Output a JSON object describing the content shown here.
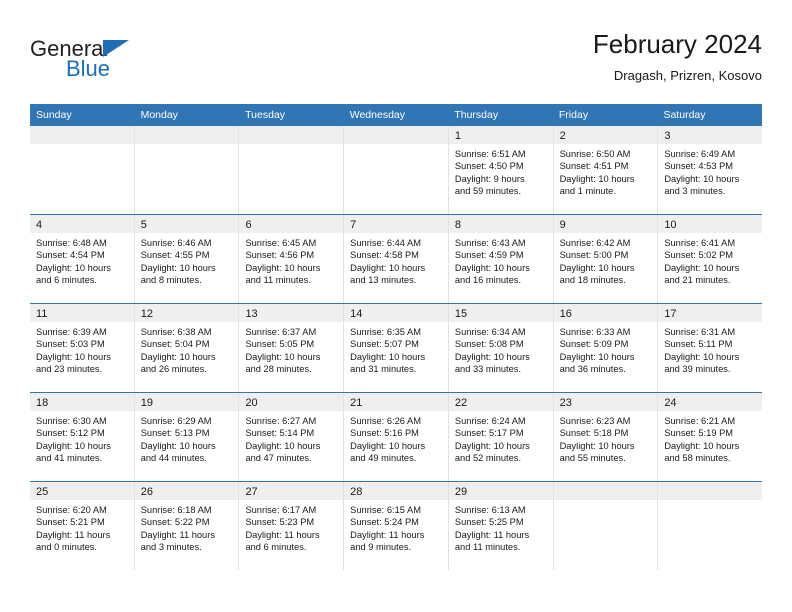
{
  "brand": {
    "name_top": "General",
    "name_bottom": "Blue",
    "triangle_icon": "triangle-icon",
    "accent_color": "#1f6eb5"
  },
  "header": {
    "title": "February 2024",
    "subtitle": "Dragash, Prizren, Kosovo"
  },
  "theme": {
    "header_blue": "#3275b5",
    "day_band_gray": "#efefef",
    "cell_border": "#e2e2e2",
    "text": "#1a1a1a"
  },
  "weekdays": [
    "Sunday",
    "Monday",
    "Tuesday",
    "Wednesday",
    "Thursday",
    "Friday",
    "Saturday"
  ],
  "weeks": [
    [
      {
        "day": "",
        "lines": []
      },
      {
        "day": "",
        "lines": []
      },
      {
        "day": "",
        "lines": []
      },
      {
        "day": "",
        "lines": []
      },
      {
        "day": "1",
        "lines": [
          "Sunrise: 6:51 AM",
          "Sunset: 4:50 PM",
          "Daylight: 9 hours",
          "and 59 minutes."
        ]
      },
      {
        "day": "2",
        "lines": [
          "Sunrise: 6:50 AM",
          "Sunset: 4:51 PM",
          "Daylight: 10 hours",
          "and 1 minute."
        ]
      },
      {
        "day": "3",
        "lines": [
          "Sunrise: 6:49 AM",
          "Sunset: 4:53 PM",
          "Daylight: 10 hours",
          "and 3 minutes."
        ]
      }
    ],
    [
      {
        "day": "4",
        "lines": [
          "Sunrise: 6:48 AM",
          "Sunset: 4:54 PM",
          "Daylight: 10 hours",
          "and 6 minutes."
        ]
      },
      {
        "day": "5",
        "lines": [
          "Sunrise: 6:46 AM",
          "Sunset: 4:55 PM",
          "Daylight: 10 hours",
          "and 8 minutes."
        ]
      },
      {
        "day": "6",
        "lines": [
          "Sunrise: 6:45 AM",
          "Sunset: 4:56 PM",
          "Daylight: 10 hours",
          "and 11 minutes."
        ]
      },
      {
        "day": "7",
        "lines": [
          "Sunrise: 6:44 AM",
          "Sunset: 4:58 PM",
          "Daylight: 10 hours",
          "and 13 minutes."
        ]
      },
      {
        "day": "8",
        "lines": [
          "Sunrise: 6:43 AM",
          "Sunset: 4:59 PM",
          "Daylight: 10 hours",
          "and 16 minutes."
        ]
      },
      {
        "day": "9",
        "lines": [
          "Sunrise: 6:42 AM",
          "Sunset: 5:00 PM",
          "Daylight: 10 hours",
          "and 18 minutes."
        ]
      },
      {
        "day": "10",
        "lines": [
          "Sunrise: 6:41 AM",
          "Sunset: 5:02 PM",
          "Daylight: 10 hours",
          "and 21 minutes."
        ]
      }
    ],
    [
      {
        "day": "11",
        "lines": [
          "Sunrise: 6:39 AM",
          "Sunset: 5:03 PM",
          "Daylight: 10 hours",
          "and 23 minutes."
        ]
      },
      {
        "day": "12",
        "lines": [
          "Sunrise: 6:38 AM",
          "Sunset: 5:04 PM",
          "Daylight: 10 hours",
          "and 26 minutes."
        ]
      },
      {
        "day": "13",
        "lines": [
          "Sunrise: 6:37 AM",
          "Sunset: 5:05 PM",
          "Daylight: 10 hours",
          "and 28 minutes."
        ]
      },
      {
        "day": "14",
        "lines": [
          "Sunrise: 6:35 AM",
          "Sunset: 5:07 PM",
          "Daylight: 10 hours",
          "and 31 minutes."
        ]
      },
      {
        "day": "15",
        "lines": [
          "Sunrise: 6:34 AM",
          "Sunset: 5:08 PM",
          "Daylight: 10 hours",
          "and 33 minutes."
        ]
      },
      {
        "day": "16",
        "lines": [
          "Sunrise: 6:33 AM",
          "Sunset: 5:09 PM",
          "Daylight: 10 hours",
          "and 36 minutes."
        ]
      },
      {
        "day": "17",
        "lines": [
          "Sunrise: 6:31 AM",
          "Sunset: 5:11 PM",
          "Daylight: 10 hours",
          "and 39 minutes."
        ]
      }
    ],
    [
      {
        "day": "18",
        "lines": [
          "Sunrise: 6:30 AM",
          "Sunset: 5:12 PM",
          "Daylight: 10 hours",
          "and 41 minutes."
        ]
      },
      {
        "day": "19",
        "lines": [
          "Sunrise: 6:29 AM",
          "Sunset: 5:13 PM",
          "Daylight: 10 hours",
          "and 44 minutes."
        ]
      },
      {
        "day": "20",
        "lines": [
          "Sunrise: 6:27 AM",
          "Sunset: 5:14 PM",
          "Daylight: 10 hours",
          "and 47 minutes."
        ]
      },
      {
        "day": "21",
        "lines": [
          "Sunrise: 6:26 AM",
          "Sunset: 5:16 PM",
          "Daylight: 10 hours",
          "and 49 minutes."
        ]
      },
      {
        "day": "22",
        "lines": [
          "Sunrise: 6:24 AM",
          "Sunset: 5:17 PM",
          "Daylight: 10 hours",
          "and 52 minutes."
        ]
      },
      {
        "day": "23",
        "lines": [
          "Sunrise: 6:23 AM",
          "Sunset: 5:18 PM",
          "Daylight: 10 hours",
          "and 55 minutes."
        ]
      },
      {
        "day": "24",
        "lines": [
          "Sunrise: 6:21 AM",
          "Sunset: 5:19 PM",
          "Daylight: 10 hours",
          "and 58 minutes."
        ]
      }
    ],
    [
      {
        "day": "25",
        "lines": [
          "Sunrise: 6:20 AM",
          "Sunset: 5:21 PM",
          "Daylight: 11 hours",
          "and 0 minutes."
        ]
      },
      {
        "day": "26",
        "lines": [
          "Sunrise: 6:18 AM",
          "Sunset: 5:22 PM",
          "Daylight: 11 hours",
          "and 3 minutes."
        ]
      },
      {
        "day": "27",
        "lines": [
          "Sunrise: 6:17 AM",
          "Sunset: 5:23 PM",
          "Daylight: 11 hours",
          "and 6 minutes."
        ]
      },
      {
        "day": "28",
        "lines": [
          "Sunrise: 6:15 AM",
          "Sunset: 5:24 PM",
          "Daylight: 11 hours",
          "and 9 minutes."
        ]
      },
      {
        "day": "29",
        "lines": [
          "Sunrise: 6:13 AM",
          "Sunset: 5:25 PM",
          "Daylight: 11 hours",
          "and 11 minutes."
        ]
      },
      {
        "day": "",
        "lines": []
      },
      {
        "day": "",
        "lines": []
      }
    ]
  ]
}
